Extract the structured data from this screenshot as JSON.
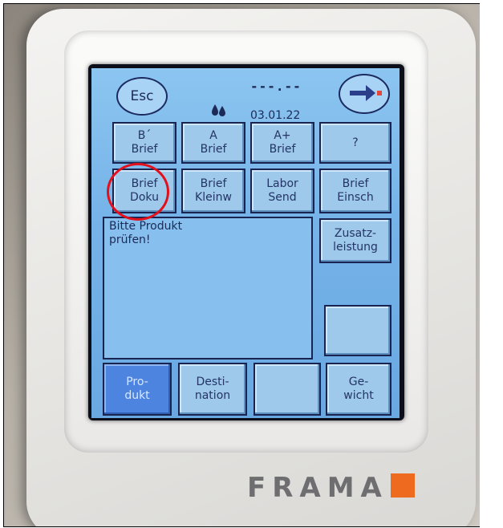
{
  "colors": {
    "accent": "#ed6a1e",
    "highlight_circle": "#e3101c",
    "lcd_blue": "#74b2e8",
    "selected_blue": "#4d84df"
  },
  "header": {
    "esc_label": "Esc",
    "dashes": "---.--",
    "date": "03.01.22",
    "ink_icon": "ink-drops-icon",
    "next_icon": "arrow-right-icon"
  },
  "product_buttons": [
    {
      "label": "B´\nBrief"
    },
    {
      "label": "A\nBrief"
    },
    {
      "label": "A+\nBrief"
    },
    {
      "label": "?"
    },
    {
      "label": "Brief\nDoku"
    },
    {
      "label": "Brief\nKleinw"
    },
    {
      "label": "Labor\nSend"
    },
    {
      "label": "Brief\nEinsch"
    }
  ],
  "message": "Bitte Produkt\nprüfen!",
  "side_buttons": [
    {
      "label": "Zusatz-\nleistung"
    },
    {
      "label": ""
    }
  ],
  "bottom_tabs": [
    {
      "label": "Pro-\ndukt"
    },
    {
      "label": "Desti-\nnation"
    },
    {
      "label": ""
    },
    {
      "label": "Ge-\nwicht"
    }
  ],
  "brand": "FRAMA"
}
